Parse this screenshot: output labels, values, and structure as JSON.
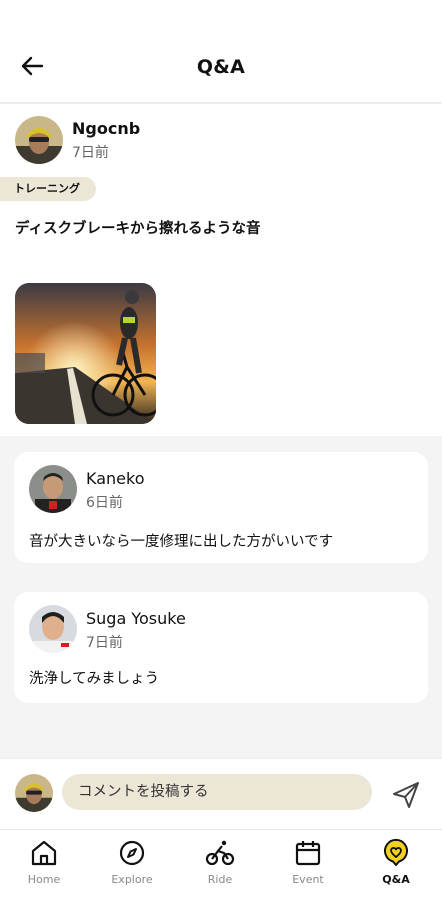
{
  "header": {
    "title": "Q&A"
  },
  "post": {
    "user": "Ngocnb",
    "time": "7日前",
    "tag": "トレーニング",
    "body": "ディスクブレーキから擦れるような音"
  },
  "comments": [
    {
      "user": "Kaneko",
      "time": "6日前",
      "text": "音が大きいなら一度修理に出した方がいいです"
    },
    {
      "user": "Suga Yosuke",
      "time": "7日前",
      "text": "洗浄してみましょう"
    }
  ],
  "comment_input": {
    "placeholder": "コメントを投稿する"
  },
  "nav": {
    "items": [
      {
        "label": "Home",
        "icon": "home-icon"
      },
      {
        "label": "Explore",
        "icon": "compass-icon"
      },
      {
        "label": "Ride",
        "icon": "bike-icon"
      },
      {
        "label": "Event",
        "icon": "calendar-icon"
      },
      {
        "label": "Q&A",
        "icon": "heart-chat-icon",
        "active": true
      }
    ]
  },
  "colors": {
    "accent": "#f3d21f",
    "tag_bg": "#ece6d6"
  }
}
